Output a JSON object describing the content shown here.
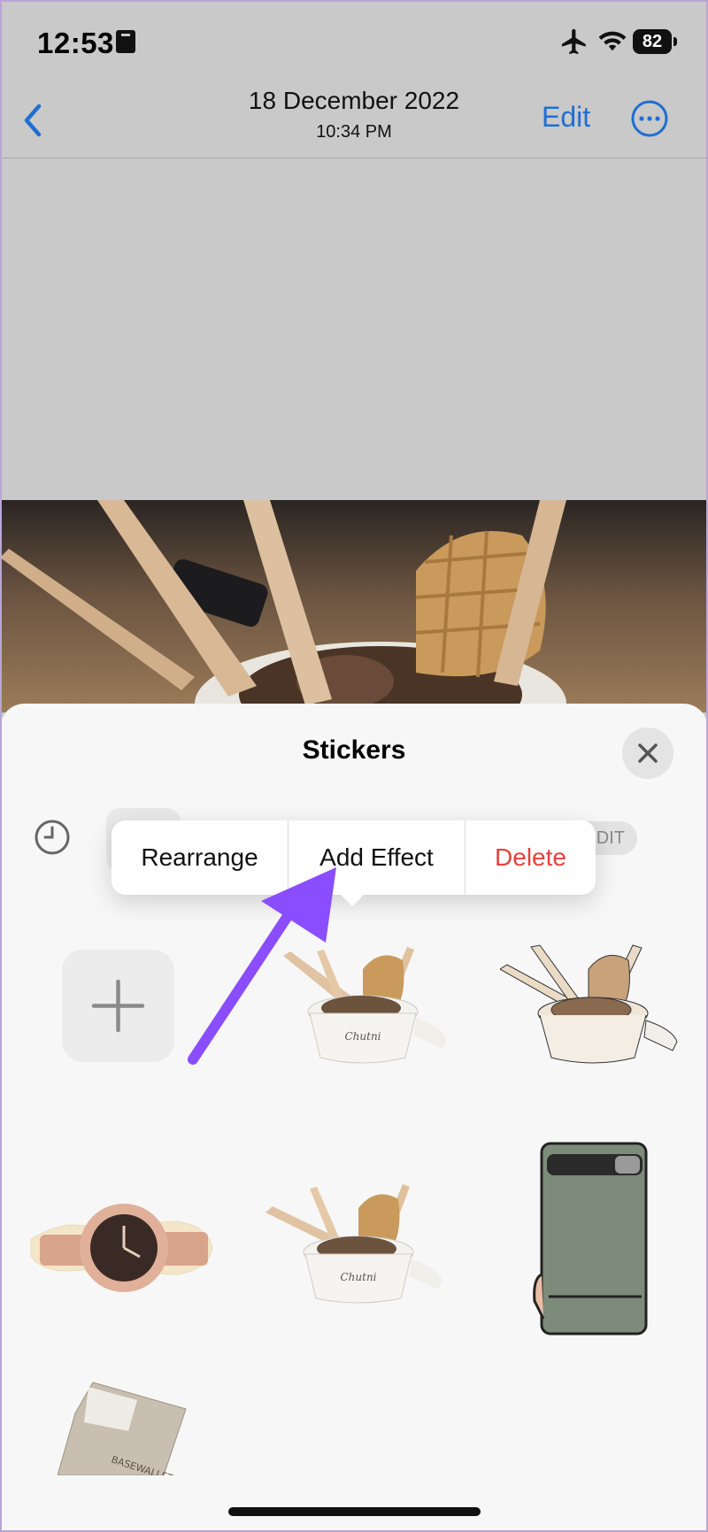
{
  "status_bar": {
    "time": "12:53",
    "battery": "82"
  },
  "nav": {
    "title": "18 December 2022",
    "subtitle": "10:34 PM",
    "edit_label": "Edit"
  },
  "sheet": {
    "title": "Stickers",
    "edit_chip": "DIT"
  },
  "context_menu": {
    "rearrange": "Rearrange",
    "add_effect": "Add Effect",
    "delete": "Delete"
  },
  "colors": {
    "accent": "#1f6fd1",
    "destructive": "#e5423b",
    "arrow": "#8a4dff"
  },
  "stickers": [
    {
      "name": "ice-cream-cup-sticker"
    },
    {
      "name": "ice-cream-cup-comic-sticker"
    },
    {
      "name": "wristwatch-sticker"
    },
    {
      "name": "ice-cream-cup-sticker-2"
    },
    {
      "name": "phone-sticker"
    },
    {
      "name": "wallet-sticker",
      "brand_text": "BASEWALLET"
    }
  ]
}
